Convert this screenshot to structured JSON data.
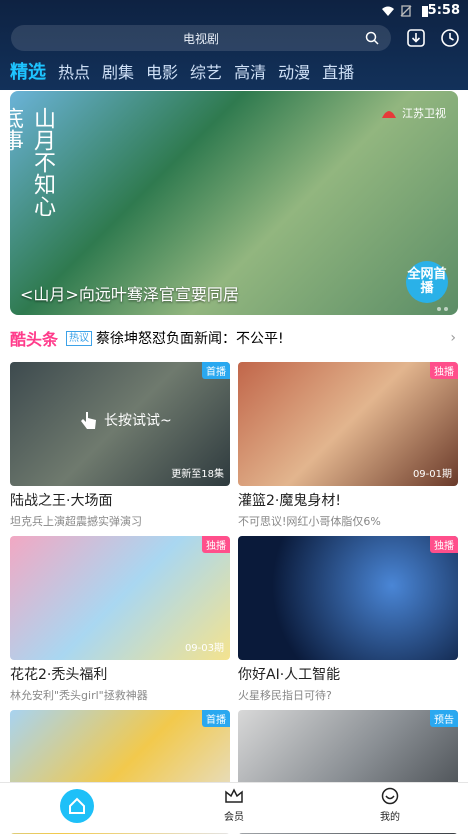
{
  "status_bar": {
    "time": "5:58"
  },
  "search": {
    "placeholder": "电视剧"
  },
  "tabs": [
    {
      "label": "精选"
    },
    {
      "label": "热点"
    },
    {
      "label": "剧集"
    },
    {
      "label": "电影"
    },
    {
      "label": "综艺"
    },
    {
      "label": "高清"
    },
    {
      "label": "动漫"
    },
    {
      "label": "直播"
    }
  ],
  "banner": {
    "title": "<山月>向远叶骞泽官宣要同居",
    "calligraphy": "山月不知心底事",
    "channel": "江苏卫视",
    "live_badge": "全网首播"
  },
  "headline": {
    "brand": "酷头条",
    "tag": "热议",
    "text": "蔡徐坤怒怼负面新闻：不公平!"
  },
  "cards": [
    {
      "title": "陆战之王·大场面",
      "subtitle": "坦克兵上演超震撼实弹演习",
      "badge": "首播",
      "duration": "更新至18集",
      "hint": "长按试试~"
    },
    {
      "title": "灌篮2·魔鬼身材!",
      "subtitle": "不可思议!网红小哥体脂仅6%",
      "badge": "独播",
      "duration": "09-01期",
      "hint": ""
    },
    {
      "title": "花花2·秃头福利",
      "subtitle": "林允安利\"秃头girl\"拯救神器",
      "badge": "独播",
      "duration": "09-03期",
      "hint": ""
    },
    {
      "title": "你好AI·人工智能",
      "subtitle": "火星移民指日可待?",
      "badge": "独播",
      "duration": "",
      "hint": ""
    },
    {
      "title": "",
      "subtitle": "",
      "badge": "首播",
      "duration": "",
      "hint": ""
    },
    {
      "title": "",
      "subtitle": "",
      "badge": "预告",
      "duration": "",
      "hint": ""
    }
  ],
  "nav": {
    "vip": "会员",
    "mine": "我的"
  },
  "colors": {
    "accent": "#1ec4ff",
    "badge_pink": "#ff4f8b",
    "badge_blue": "#2aa8f0",
    "brand_pink": "#ff3c8b"
  }
}
